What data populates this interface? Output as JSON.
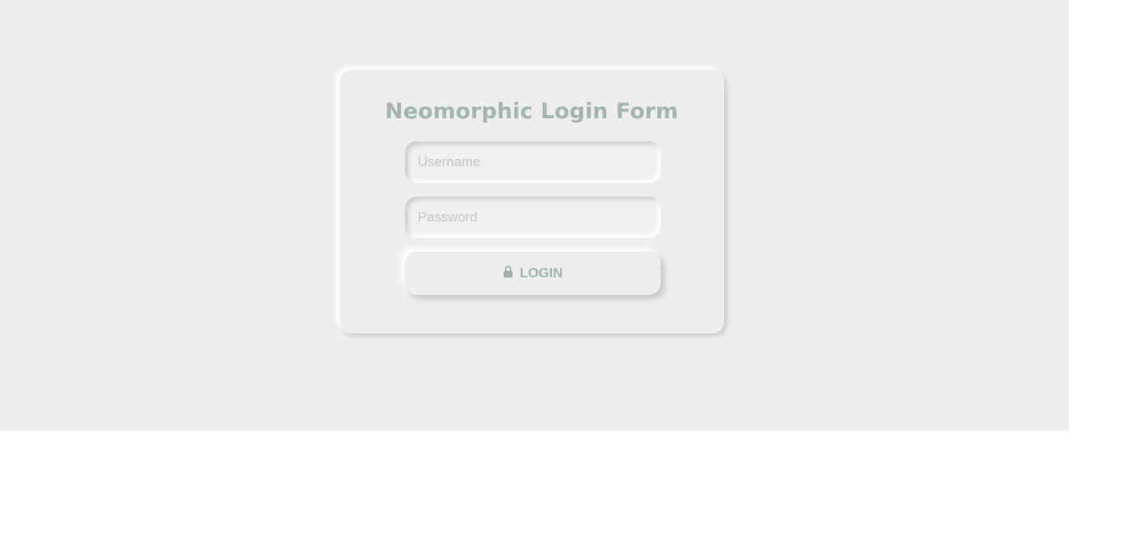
{
  "form": {
    "title": "Neomorphic Login Form",
    "username_placeholder": "Username",
    "password_placeholder": "Password",
    "login_label": "LOGIN",
    "login_icon": "lock-icon"
  },
  "colors": {
    "background": "#ededed",
    "accent": "#a3b3b1",
    "placeholder": "#c4c4c4"
  }
}
